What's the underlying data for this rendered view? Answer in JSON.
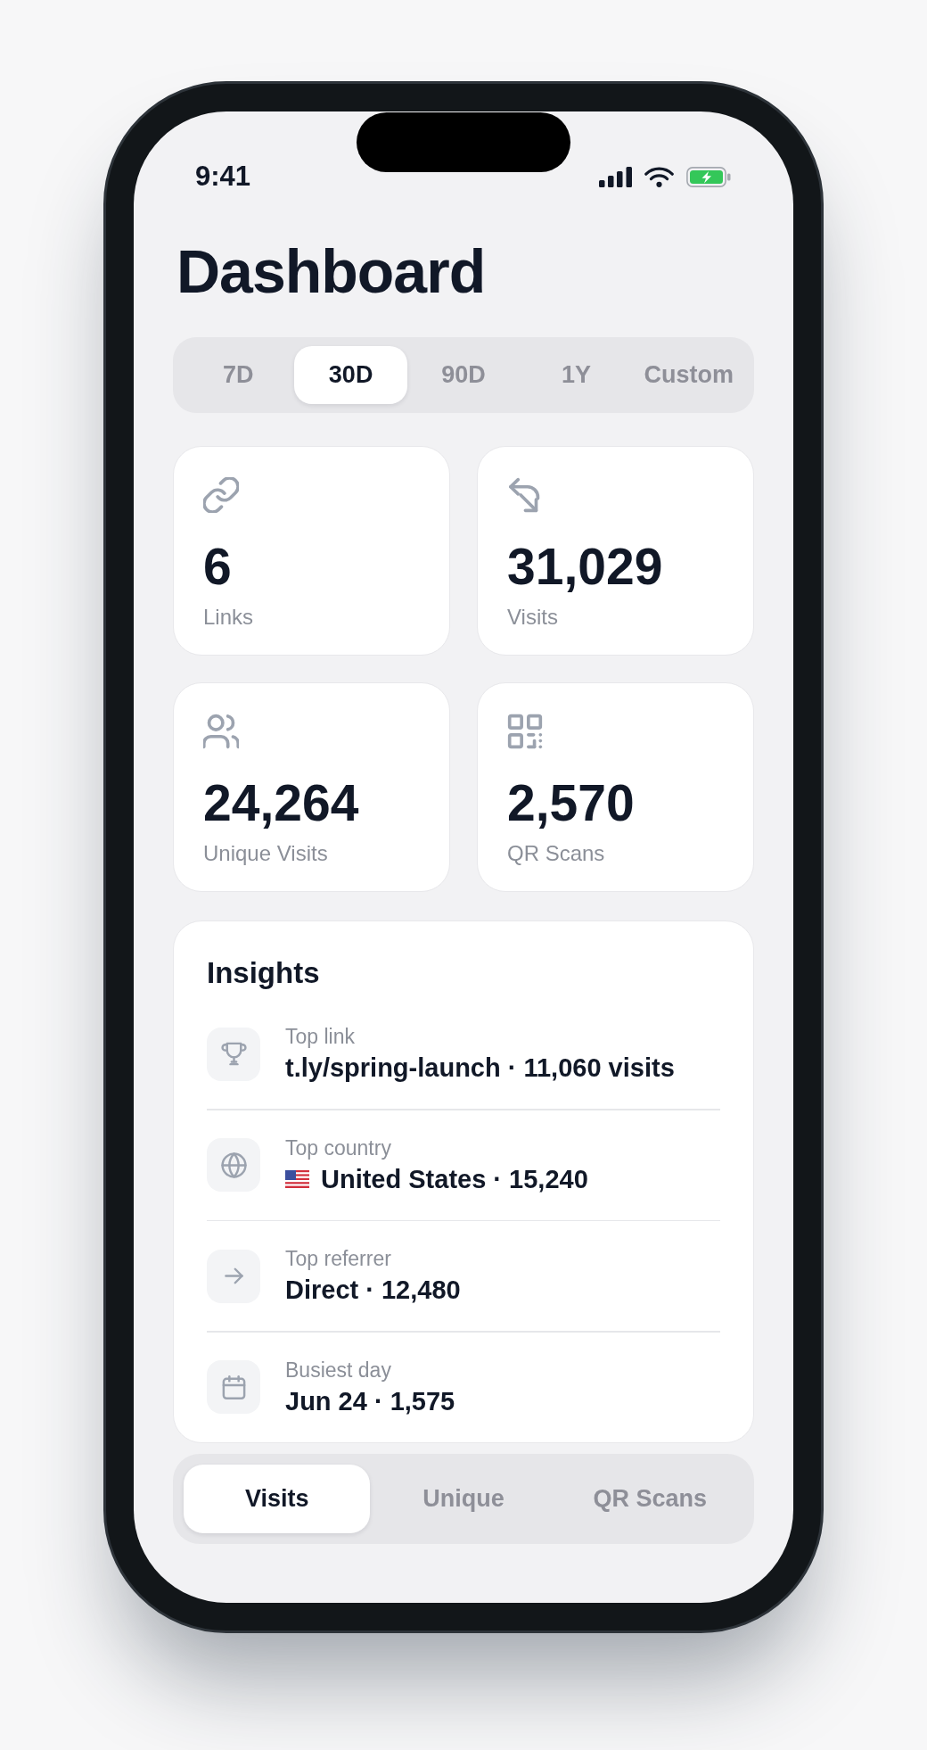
{
  "status_bar": {
    "time": "9:41"
  },
  "title": "Dashboard",
  "range_tabs": [
    {
      "label": "7D",
      "selected": false
    },
    {
      "label": "30D",
      "selected": true
    },
    {
      "label": "90D",
      "selected": false
    },
    {
      "label": "1Y",
      "selected": false
    },
    {
      "label": "Custom",
      "selected": false
    }
  ],
  "stats": [
    {
      "kind": "links",
      "value": "6",
      "label": "Links"
    },
    {
      "kind": "visits",
      "value": "31,029",
      "label": "Visits"
    },
    {
      "kind": "unique",
      "value": "24,264",
      "label": "Unique Visits"
    },
    {
      "kind": "scans",
      "value": "2,570",
      "label": "QR Scans"
    }
  ],
  "insights": {
    "title": "Insights",
    "items": [
      {
        "kind": "link",
        "label": "Top link",
        "value": "t.ly/spring-launch · 11,060 visits"
      },
      {
        "kind": "country",
        "label": "Top country",
        "value": "United States · 15,240"
      },
      {
        "kind": "referrer",
        "label": "Top referrer",
        "value": "Direct · 12,480"
      },
      {
        "kind": "day",
        "label": "Busiest day",
        "value": "Jun 24 · 1,575"
      }
    ]
  },
  "metric_tabs": [
    {
      "label": "Visits",
      "selected": true
    },
    {
      "label": "Unique",
      "selected": false
    },
    {
      "label": "QR Scans",
      "selected": false
    }
  ]
}
